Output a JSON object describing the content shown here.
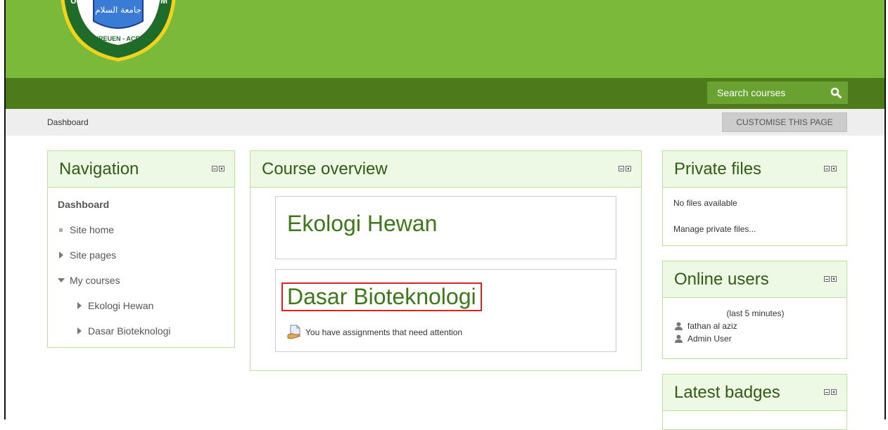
{
  "header": {
    "logo_text_arabic": "جامعة السلام",
    "logo_text_bottom": "BIREUEN - ACEH",
    "logo_side_left": "U",
    "logo_side_right": "M"
  },
  "search": {
    "placeholder": "Search courses",
    "icon": "search-icon"
  },
  "breadcrumb": {
    "home": "Dashboard"
  },
  "customise_button": "CUSTOMISE THIS PAGE",
  "navigation": {
    "title": "Navigation",
    "dashboard": "Dashboard",
    "site_home": "Site home",
    "site_pages": "Site pages",
    "my_courses": "My courses",
    "courses": [
      "Ekologi Hewan",
      "Dasar Bioteknologi"
    ]
  },
  "course_overview": {
    "title": "Course overview",
    "courses": [
      {
        "name": "Ekologi Hewan"
      },
      {
        "name": "Dasar Bioteknologi",
        "notice": "You have assignments that need attention"
      }
    ]
  },
  "private_files": {
    "title": "Private files",
    "empty": "No files available",
    "manage_link": "Manage private files..."
  },
  "online_users": {
    "title": "Online users",
    "period": "(last 5 minutes)",
    "users": [
      "fathan al aziz",
      "Admin User"
    ]
  },
  "latest_badges": {
    "title": "Latest badges"
  },
  "colors": {
    "header_green": "#7ab93a",
    "navbar_green": "#4d7a1b",
    "block_header_bg": "#eef9e5",
    "title_green": "#2f5c12",
    "highlight_red": "#e02020"
  }
}
